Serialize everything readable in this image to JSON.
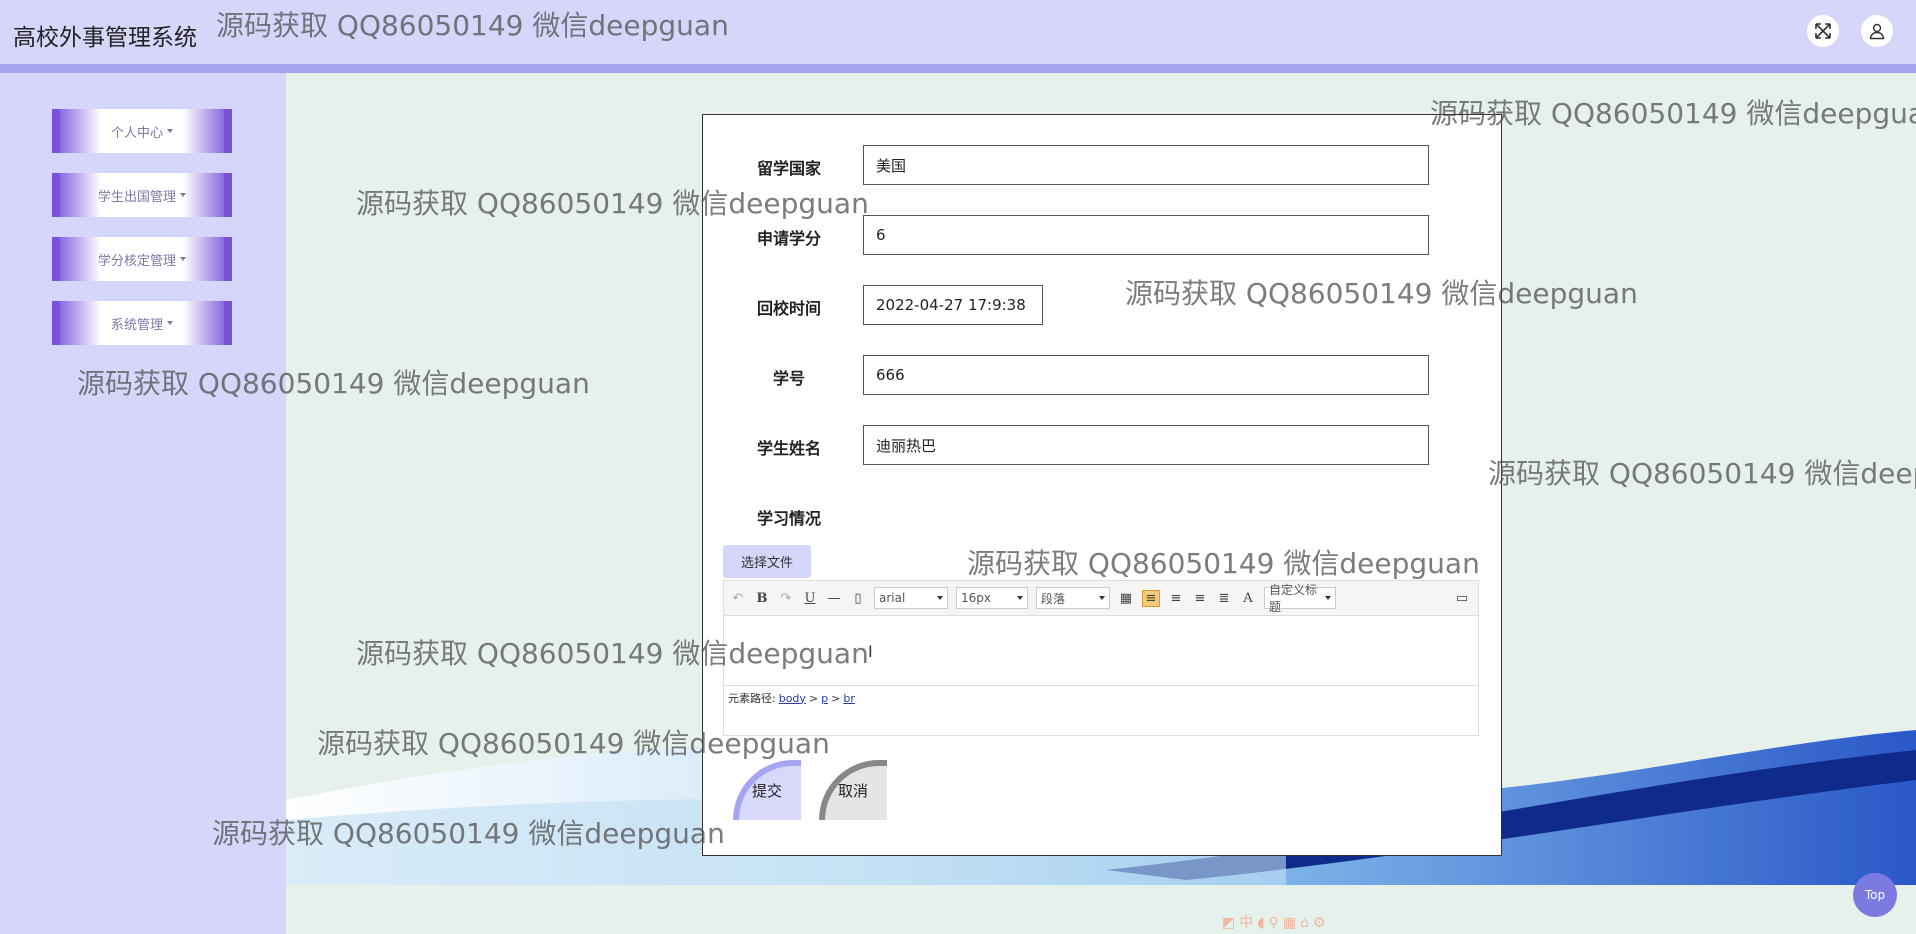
{
  "app": {
    "title": "高校外事管理系统"
  },
  "watermark_text": "源码获取 QQ86050149 微信deepguan",
  "header": {
    "fullscreen_icon": "expand-icon",
    "user_icon": "user-icon"
  },
  "sidebar": {
    "items": [
      {
        "label": "个人中心"
      },
      {
        "label": "学生出国管理"
      },
      {
        "label": "学分核定管理"
      },
      {
        "label": "系统管理"
      }
    ]
  },
  "form": {
    "fields": [
      {
        "label": "留学国家",
        "value": "美国"
      },
      {
        "label": "申请学分",
        "value": "6"
      },
      {
        "label": "回校时间",
        "value": "2022-04-27 17:9:38"
      },
      {
        "label": "学号",
        "value": "666"
      },
      {
        "label": "学生姓名",
        "value": "迪丽热巴"
      }
    ],
    "study_label": "学习情况",
    "file_button": "选择文件",
    "editor": {
      "font_family": "arial",
      "font_size": "16px",
      "paragraph": "段落",
      "custom_heading": "自定义标题",
      "path_label": "元素路径:",
      "path_items": [
        "body",
        "p",
        "br"
      ]
    },
    "submit_label": "提交",
    "cancel_label": "取消"
  },
  "top_button": "Top",
  "colors": {
    "header_bg": "#d6d6fb",
    "accent": "#7a52d8",
    "main_bg": "#e6f1ec"
  }
}
